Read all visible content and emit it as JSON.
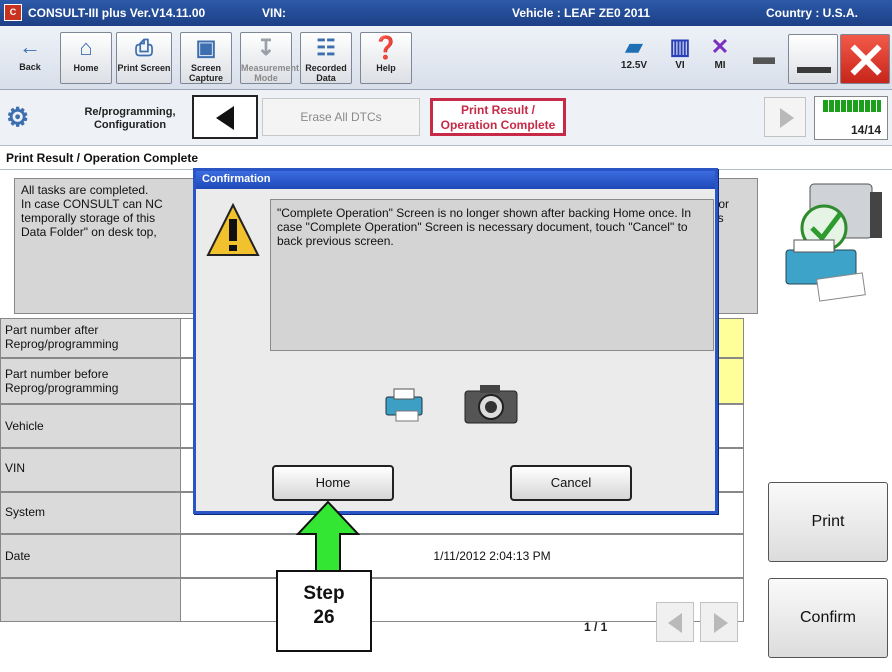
{
  "titlebar": {
    "app_title": "CONSULT-III plus  Ver.V14.11.00",
    "vin_label": "VIN:",
    "vehicle": "Vehicle : LEAF ZE0 2011",
    "country": "Country : U.S.A."
  },
  "toolbar": {
    "back": "Back",
    "home": "Home",
    "print_screen": "Print Screen",
    "screen_capture": "Screen Capture",
    "measurement_mode": "Measurement Mode",
    "recorded_data": "Recorded Data",
    "help": "Help",
    "battery_voltage": "12.5V",
    "vi": "VI",
    "mi": "MI"
  },
  "breadcrumb": {
    "home_label": "Re/programming, Configuration",
    "prev_step": "Erase All DTCs",
    "active_step": "Print Result / Operation Complete",
    "progress": "14/14"
  },
  "section_title": "Print Result / Operation Complete",
  "message": {
    "line1": "All tasks are completed.",
    "line2": "In case CONSULT can NC",
    "line3": "temporally storage of this",
    "line4": "Data Folder\" on desk top,",
    "right1": "for",
    "right2": "is"
  },
  "table": {
    "rows": [
      {
        "label": "Part number after Reprog/programming",
        "value": ""
      },
      {
        "label": "Part number before Reprog/programming",
        "value": ""
      },
      {
        "label": "Vehicle",
        "value": ""
      },
      {
        "label": "VIN",
        "value": ""
      },
      {
        "label": "System",
        "value": ""
      },
      {
        "label": "Date",
        "value": "1/11/2012 2:04:13 PM"
      },
      {
        "label": "",
        "value": ""
      }
    ],
    "pager": "1 / 1"
  },
  "side_buttons": {
    "print": "Print",
    "confirm": "Confirm"
  },
  "dialog": {
    "title": "Confirmation",
    "message": "\"Complete Operation\" Screen is no longer shown after backing Home once. In case \"Complete Operation\" Screen is necessary document, touch \"Cancel\" to back previous screen.",
    "home_button": "Home",
    "cancel_button": "Cancel"
  },
  "step": {
    "line1": "Step",
    "line2": "26"
  },
  "colors": {
    "title_bar": "#1c3f86",
    "active_step": "#c62a47",
    "dialog_border": "#2a55c4",
    "arrow": "#33e633",
    "highlight": "#ffff99"
  }
}
